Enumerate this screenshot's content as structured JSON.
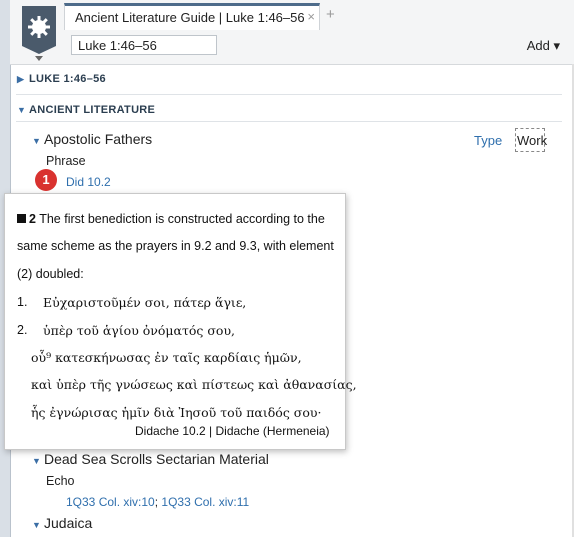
{
  "header": {
    "tab_title": "Ancient Literature Guide | Luke 1:46–56",
    "tab_close": "×",
    "tab_add": "+",
    "reference_value": "Luke 1:46–56",
    "add_label": "Add ▾"
  },
  "sections": {
    "first_title": "LUKE 1:46–56",
    "second_title": "ANCIENT LITERATURE"
  },
  "controls": {
    "type_label": "Type",
    "work_label": "Work"
  },
  "apostolic": {
    "title": "Apostolic Fathers",
    "phrase_label": "Phrase",
    "link": "Did 10.2",
    "badge": "1"
  },
  "tooltip": {
    "heading_num": "2",
    "line1": "The first benediction is constructed according to the",
    "line2": "same scheme as the prayers in 9.2 and 9.3, with element",
    "line3": "(2) doubled:",
    "item1_num": "1.",
    "item1_text": "Εὐχαριστοῦμέν σοι, πάτερ ἅγιε,",
    "item2_num": "2.",
    "item2_text": "ὑπὲρ τοῦ ἁγίου ὀνόματός σου,",
    "greek3": "οὗ⁹ κατεσκήνωσας ἐν ταῖς καρδίαις ἡμῶν,",
    "greek4": "καὶ ὑπὲρ τῆς γνώσεως καὶ πίστεως καὶ ἀθανασίας,",
    "greek5": "ἧς ἐγνώρισας ἡμῖν διὰ Ἰησοῦ τοῦ παιδός σου·",
    "source": "Didache 10.2 | Didache (Hermeneia)"
  },
  "deadsea": {
    "title": "Dead Sea Scrolls Sectarian Material",
    "echo_label": "Echo",
    "link1": "1Q33 Col. xiv:10",
    "separator": "; ",
    "link2": "1Q33 Col. xiv:11"
  },
  "judaica": {
    "title": "Judaica"
  }
}
